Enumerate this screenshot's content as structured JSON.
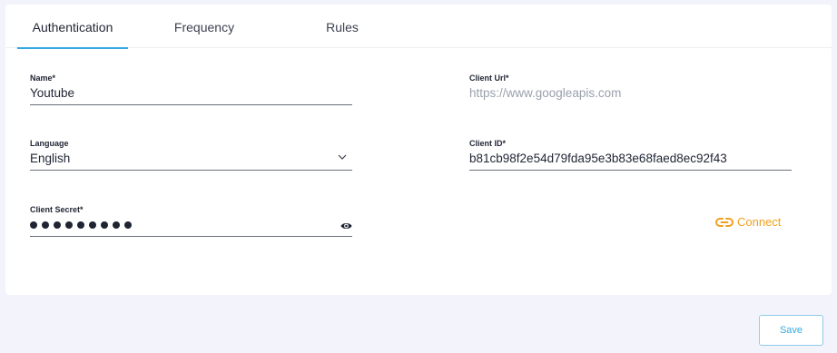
{
  "tabs": [
    {
      "label": "Authentication",
      "active": true
    },
    {
      "label": "Frequency",
      "active": false
    },
    {
      "label": "Rules",
      "active": false
    }
  ],
  "form": {
    "name": {
      "label": "Name*",
      "value": "Youtube"
    },
    "client_url": {
      "label": "Client Url*",
      "placeholder": "https://www.googleapis.com"
    },
    "language": {
      "label": "Language",
      "value": "English"
    },
    "client_id": {
      "label": "Client ID*",
      "value": "b81cb98f2e54d79fda95e3b83e68faed8ec92f43"
    },
    "client_secret": {
      "label": "Client Secret*",
      "masked_length": 9
    }
  },
  "connect": {
    "label": "Connect",
    "icon": "link-icon"
  },
  "footer": {
    "save_label": "Save"
  },
  "colors": {
    "accent": "#35a8df",
    "connect": "#f0a020",
    "background": "#f3f4fb"
  }
}
